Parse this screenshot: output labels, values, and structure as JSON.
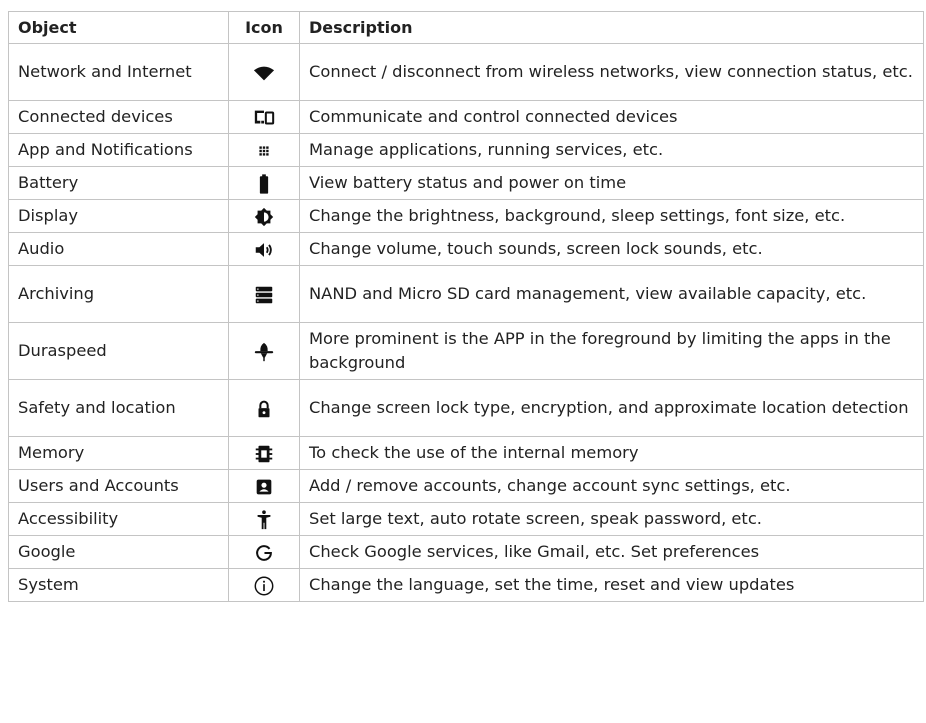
{
  "headers": {
    "object": "Object",
    "icon": "Icon",
    "description": "Description"
  },
  "rows": [
    {
      "object": "Network and Internet",
      "icon": "wifi-icon",
      "description": "Connect / disconnect from wireless networks, view connection status, etc."
    },
    {
      "object": "Connected devices",
      "icon": "devices-icon",
      "description": "Communicate and control connected devices"
    },
    {
      "object": "App and Notifications",
      "icon": "apps-grid-icon",
      "description": "Manage applications, running services, etc."
    },
    {
      "object": "Battery",
      "icon": "battery-icon",
      "description": "View battery status and power on time"
    },
    {
      "object": "Display",
      "icon": "brightness-icon",
      "description": "Change the brightness, background, sleep settings, font size, etc."
    },
    {
      "object": "Audio",
      "icon": "volume-icon",
      "description": "Change volume, touch sounds, screen lock sounds, etc."
    },
    {
      "object": "Archiving",
      "icon": "storage-icon",
      "description": "NAND and Micro SD card management, view available capacity, etc."
    },
    {
      "object": "Duraspeed",
      "icon": "rocket-icon",
      "description": "More prominent is the APP in the foreground by limiting the apps in the background"
    },
    {
      "object": "Safety and location",
      "icon": "lock-icon",
      "description": "Change screen lock type, encryption, and approximate location detection"
    },
    {
      "object": "Memory",
      "icon": "memory-icon",
      "description": "To check the use of the internal memory"
    },
    {
      "object": "Users and Accounts",
      "icon": "account-icon",
      "description": "Add / remove accounts, change account sync settings, etc."
    },
    {
      "object": "Accessibility",
      "icon": "accessibility-icon",
      "description": "Set large text, auto rotate screen, speak password, etc."
    },
    {
      "object": "Google",
      "icon": "google-icon",
      "description": "Check Google services, like Gmail, etc. Set preferences"
    },
    {
      "object": "System",
      "icon": "info-icon",
      "description": "Change the language, set the time, reset and view updates"
    }
  ]
}
